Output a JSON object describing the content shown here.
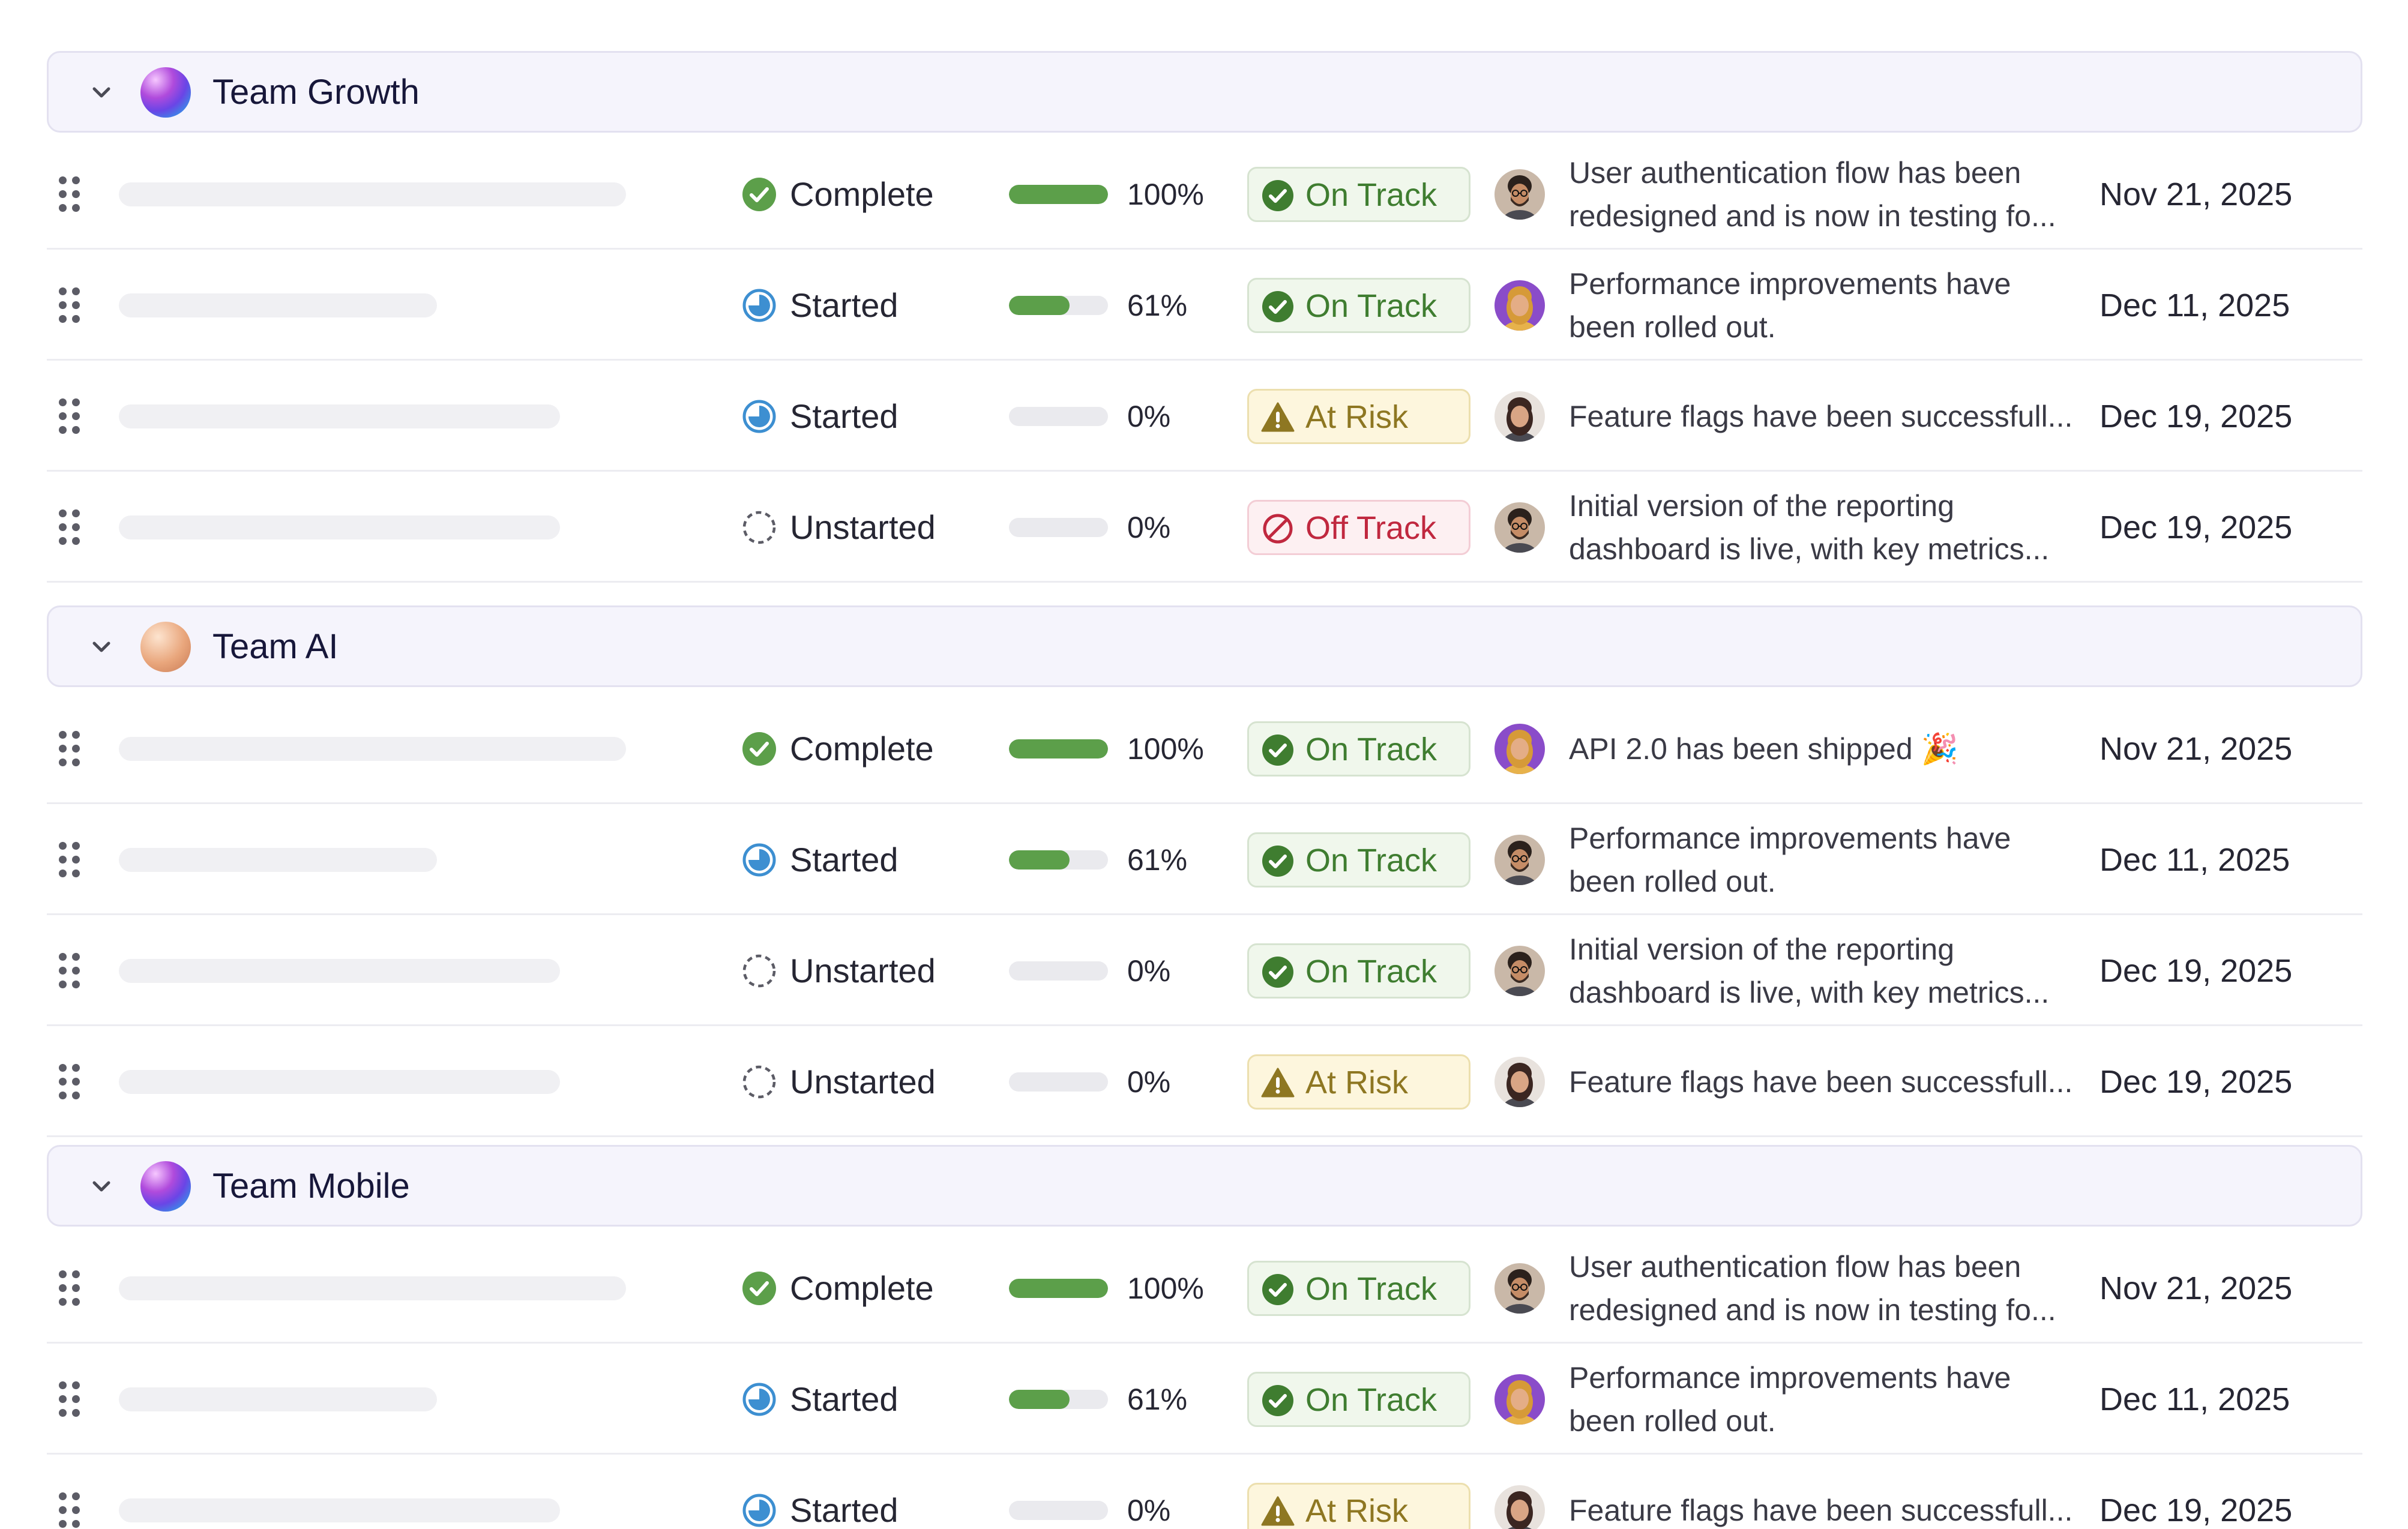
{
  "groups": [
    {
      "name": "Team Growth",
      "avatar": "violet-cyan-sphere",
      "rows": [
        {
          "status": "Complete",
          "status_icon": "check-circle-icon",
          "progress": 100,
          "progress_label": "100%",
          "health": "On Track",
          "health_kind": "on",
          "update": [
            "User authentication flow has been",
            "redesigned and is now in testing fo..."
          ],
          "date": "Nov 21, 2025",
          "person": "bearded-man-glasses"
        },
        {
          "status": "Started",
          "status_icon": "started-clock-icon",
          "progress": 61,
          "progress_label": "61%",
          "health": "On Track",
          "health_kind": "on",
          "update": [
            "Performance improvements have",
            "been rolled out."
          ],
          "date": "Dec 11, 2025",
          "person": "woman-purple-bg"
        },
        {
          "status": "Started",
          "status_icon": "started-clock-icon",
          "progress": 0,
          "progress_label": "0%",
          "health": "At Risk",
          "health_kind": "risk",
          "update": [
            "Feature flags have been successfull..."
          ],
          "date": "Dec 19, 2025",
          "person": "woman-dark-hair"
        },
        {
          "status": "Unstarted",
          "status_icon": "dashed-circle-icon",
          "progress": 0,
          "progress_label": "0%",
          "health": "Off Track",
          "health_kind": "off",
          "update": [
            "Initial version of the reporting",
            "dashboard is live, with key metrics..."
          ],
          "date": "Dec 19, 2025",
          "person": "bearded-man-glasses"
        }
      ]
    },
    {
      "name": "Team AI",
      "avatar": "peach-sphere",
      "rows": [
        {
          "status": "Complete",
          "status_icon": "check-circle-icon",
          "progress": 100,
          "progress_label": "100%",
          "health": "On Track",
          "health_kind": "on",
          "update": [
            "API 2.0 has been shipped 🎉"
          ],
          "date": "Nov 21, 2025",
          "person": "woman-purple-bg"
        },
        {
          "status": "Started",
          "status_icon": "started-clock-icon",
          "progress": 61,
          "progress_label": "61%",
          "health": "On Track",
          "health_kind": "on",
          "update": [
            "Performance improvements have",
            "been rolled out."
          ],
          "date": "Dec 11, 2025",
          "person": "bearded-man-glasses"
        },
        {
          "status": "Unstarted",
          "status_icon": "dashed-circle-icon",
          "progress": 0,
          "progress_label": "0%",
          "health": "On Track",
          "health_kind": "on",
          "update": [
            "Initial version of the reporting",
            "dashboard is live, with key metrics..."
          ],
          "date": "Dec 19, 2025",
          "person": "bearded-man-glasses"
        },
        {
          "status": "Unstarted",
          "status_icon": "dashed-circle-icon",
          "progress": 0,
          "progress_label": "0%",
          "health": "At Risk",
          "health_kind": "risk",
          "update": [
            "Feature flags have been successfull..."
          ],
          "date": "Dec 19, 2025",
          "person": "woman-dark-hair"
        }
      ]
    },
    {
      "name": "Team Mobile",
      "avatar": "violet-cyan-sphere",
      "rows": [
        {
          "status": "Complete",
          "status_icon": "check-circle-icon",
          "progress": 100,
          "progress_label": "100%",
          "health": "On Track",
          "health_kind": "on",
          "update": [
            "User authentication flow has been",
            "redesigned and is now in testing fo..."
          ],
          "date": "Nov 21, 2025",
          "person": "bearded-man-glasses"
        },
        {
          "status": "Started",
          "status_icon": "started-clock-icon",
          "progress": 61,
          "progress_label": "61%",
          "health": "On Track",
          "health_kind": "on",
          "update": [
            "Performance improvements have",
            "been rolled out."
          ],
          "date": "Dec 11, 2025",
          "person": "woman-purple-bg"
        },
        {
          "status": "Started",
          "status_icon": "started-clock-icon",
          "progress": 0,
          "progress_label": "0%",
          "health": "At Risk",
          "health_kind": "risk",
          "update": [
            "Feature flags have been successfull..."
          ],
          "date": "Dec 19, 2025",
          "person": "woman-dark-hair"
        }
      ]
    }
  ],
  "colors": {
    "progress_fill": "#5c9f4a",
    "on_track": "#3f7d30",
    "at_risk": "#8e7722",
    "off_track": "#c0283f",
    "started_blue": "#3d8fd1"
  }
}
